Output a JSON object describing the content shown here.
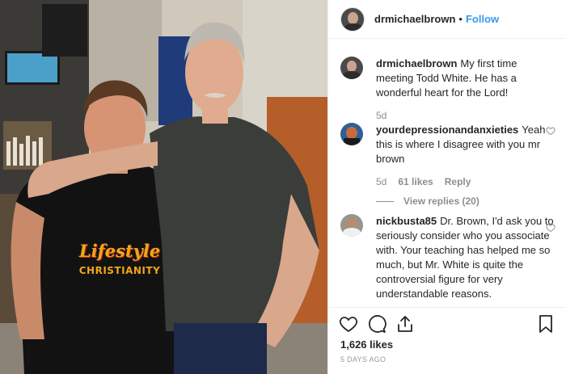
{
  "post": {
    "username": "drmichaelbrown",
    "dot": "•",
    "follow_label": "Follow",
    "shirt_text": "Lifestyle",
    "shirt_subtext": "CHRISTIANITY"
  },
  "comments": [
    {
      "username": "drmichaelbrown",
      "text": "My first time meeting Todd White. He has a wonderful heart for the Lord!",
      "age": "5d"
    },
    {
      "username": "yourdepressionandanxieties",
      "text": "Yeah this is where I disagree with you mr brown",
      "age": "5d",
      "likes": "61 likes",
      "reply_label": "Reply",
      "view_replies": "View replies (20)"
    },
    {
      "username": "nickbusta85",
      "text": "Dr. Brown, I'd ask you to seriously consider who you associate with. Your teaching has helped me so much, but Mr. White is quite the controversial figure for very understandable reasons."
    }
  ],
  "stats": {
    "likes": "1,626 likes",
    "time_ago": "5 DAYS AGO"
  },
  "icons": [
    "heart-icon",
    "comment-icon",
    "share-icon",
    "bookmark-icon"
  ]
}
